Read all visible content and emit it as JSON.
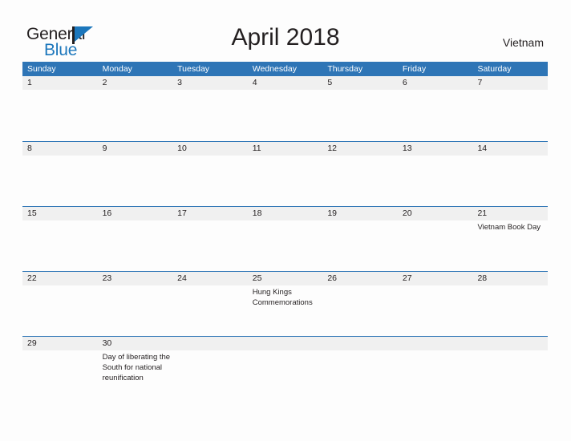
{
  "brand": {
    "name_part1": "General",
    "name_part2": "Blue",
    "accent_color": "#1c77bc"
  },
  "header": {
    "title": "April 2018",
    "country": "Vietnam"
  },
  "calendar": {
    "header_color": "#2e75b6",
    "band_color": "#f0f0f0",
    "weekdays": [
      "Sunday",
      "Monday",
      "Tuesday",
      "Wednesday",
      "Thursday",
      "Friday",
      "Saturday"
    ],
    "weeks": [
      [
        {
          "date": "1",
          "events": []
        },
        {
          "date": "2",
          "events": []
        },
        {
          "date": "3",
          "events": []
        },
        {
          "date": "4",
          "events": []
        },
        {
          "date": "5",
          "events": []
        },
        {
          "date": "6",
          "events": []
        },
        {
          "date": "7",
          "events": []
        }
      ],
      [
        {
          "date": "8",
          "events": []
        },
        {
          "date": "9",
          "events": []
        },
        {
          "date": "10",
          "events": []
        },
        {
          "date": "11",
          "events": []
        },
        {
          "date": "12",
          "events": []
        },
        {
          "date": "13",
          "events": []
        },
        {
          "date": "14",
          "events": []
        }
      ],
      [
        {
          "date": "15",
          "events": []
        },
        {
          "date": "16",
          "events": []
        },
        {
          "date": "17",
          "events": []
        },
        {
          "date": "18",
          "events": []
        },
        {
          "date": "19",
          "events": []
        },
        {
          "date": "20",
          "events": []
        },
        {
          "date": "21",
          "events": [
            "Vietnam Book Day"
          ]
        }
      ],
      [
        {
          "date": "22",
          "events": []
        },
        {
          "date": "23",
          "events": []
        },
        {
          "date": "24",
          "events": []
        },
        {
          "date": "25",
          "events": [
            "Hung Kings Commemorations"
          ]
        },
        {
          "date": "26",
          "events": []
        },
        {
          "date": "27",
          "events": []
        },
        {
          "date": "28",
          "events": []
        }
      ],
      [
        {
          "date": "29",
          "events": []
        },
        {
          "date": "30",
          "events": [
            "Day of liberating the South for national reunification"
          ]
        },
        {
          "date": "",
          "events": []
        },
        {
          "date": "",
          "events": []
        },
        {
          "date": "",
          "events": []
        },
        {
          "date": "",
          "events": []
        },
        {
          "date": "",
          "events": []
        }
      ]
    ]
  }
}
